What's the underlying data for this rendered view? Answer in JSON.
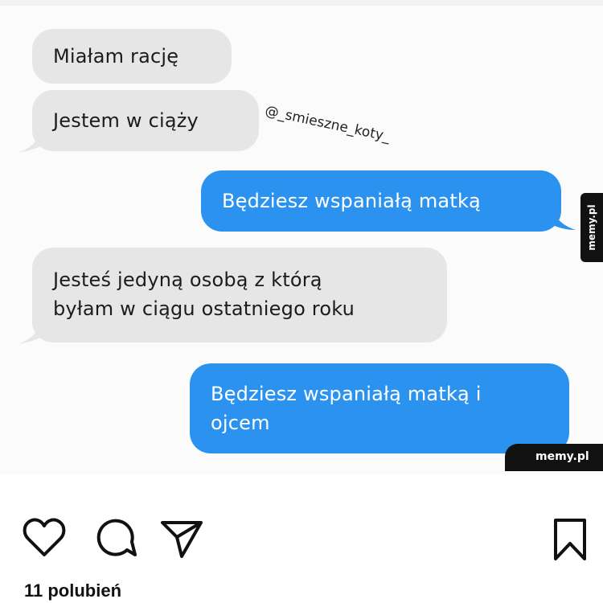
{
  "messages": [
    {
      "side": "in",
      "text": "Miałam rację"
    },
    {
      "side": "in",
      "text": "Jestem w ciąży"
    },
    {
      "side": "out",
      "text": "Będziesz wspaniałą matką"
    },
    {
      "side": "in",
      "line1": "Jesteś jedyną osobą z którą",
      "line2": "byłam w ciągu ostatniego roku"
    },
    {
      "side": "out",
      "line1": "Będziesz wspaniałą matką i",
      "line2": "ojcem"
    }
  ],
  "watermark": {
    "handle": "@_smieszne_koty_",
    "side_logo": "memy.pl",
    "corner_logo": "memy.pl"
  },
  "colors": {
    "incoming_bubble": "#e6e6e6",
    "outgoing_bubble": "#2b93ef"
  },
  "actions": {
    "like_icon": "heart-icon",
    "comment_icon": "comment-icon",
    "share_icon": "send-icon",
    "save_icon": "bookmark-icon"
  },
  "likes_text": "11 polubień"
}
